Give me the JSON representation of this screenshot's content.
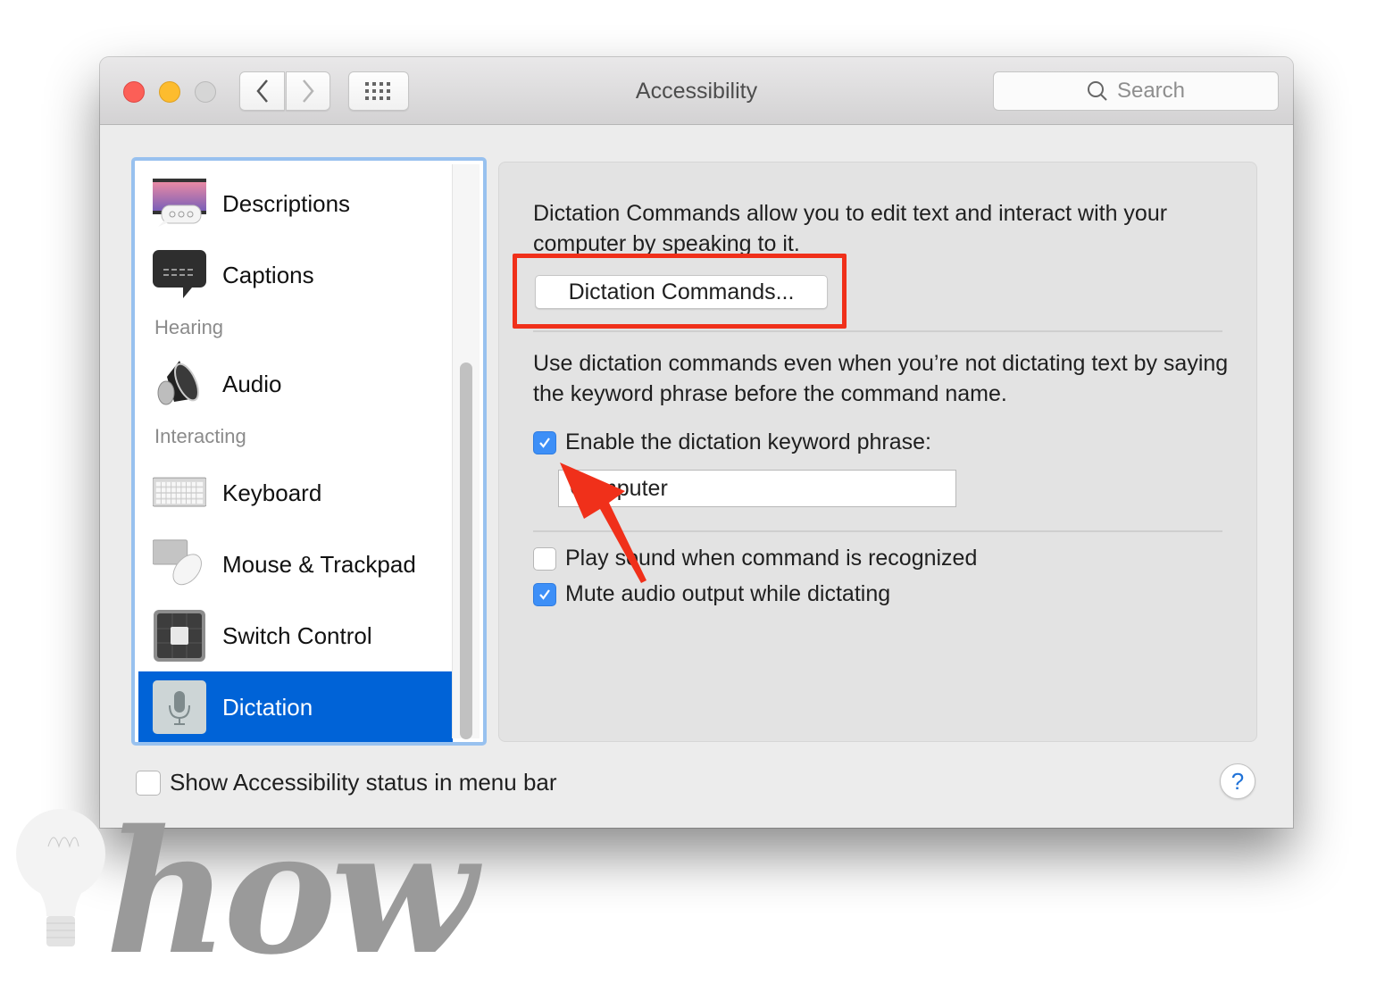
{
  "window": {
    "title": "Accessibility",
    "traffic_lights": [
      "close",
      "minimize",
      "zoom-disabled"
    ],
    "nav": {
      "back_icon": "chevron-left-icon",
      "forward_icon": "chevron-right-icon",
      "grid_icon": "grid-icon"
    },
    "search": {
      "placeholder": "Search",
      "icon": "search-icon"
    }
  },
  "sidebar": {
    "items": [
      {
        "type": "item",
        "label": "Descriptions",
        "icon": "descriptions-icon"
      },
      {
        "type": "item",
        "label": "Captions",
        "icon": "captions-icon"
      },
      {
        "type": "section",
        "label": "Hearing"
      },
      {
        "type": "item",
        "label": "Audio",
        "icon": "speaker-icon"
      },
      {
        "type": "section",
        "label": "Interacting"
      },
      {
        "type": "item",
        "label": "Keyboard",
        "icon": "keyboard-icon"
      },
      {
        "type": "item",
        "label": "Mouse & Trackpad",
        "icon": "mouse-icon"
      },
      {
        "type": "item",
        "label": "Switch Control",
        "icon": "switch-control-icon"
      },
      {
        "type": "item",
        "label": "Dictation",
        "icon": "microphone-icon",
        "selected": true
      }
    ]
  },
  "panel": {
    "intro": "Dictation Commands allow you to edit text and interact with your computer by speaking to it.",
    "commands_button": "Dictation Commands...",
    "keyword_description": "Use dictation commands even when you’re not dictating text by saying the keyword phrase before the command name.",
    "enable_keyword": {
      "label": "Enable the dictation keyword phrase:",
      "checked": true
    },
    "keyword_value": "Computer",
    "keyword_visible": "mputer",
    "play_sound": {
      "label": "Play sound when command is recognized",
      "checked": false
    },
    "mute_audio": {
      "label": "Mute audio output while dictating",
      "checked": true
    }
  },
  "footer": {
    "show_status": {
      "label": "Show Accessibility status in menu bar",
      "checked": false
    },
    "help": "?"
  },
  "annotations": {
    "highlight_color": "#f0301a",
    "arrow_color": "#f0301a"
  },
  "watermark": {
    "text": "how"
  }
}
